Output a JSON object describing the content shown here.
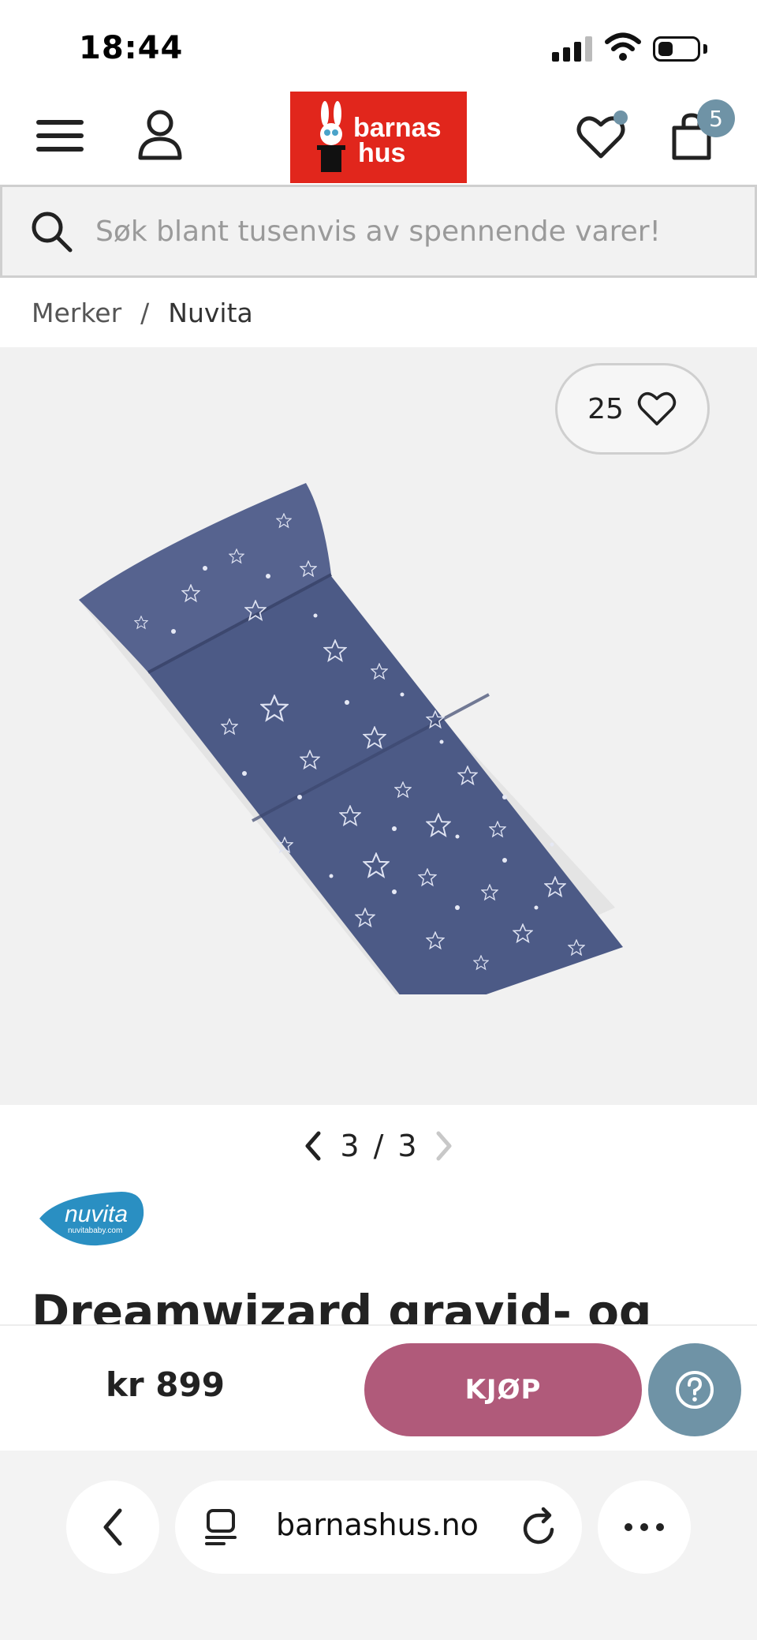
{
  "status_bar": {
    "time": "18:44"
  },
  "header": {
    "logo_text_line1": "barnas",
    "logo_text_line2": "hus",
    "cart_count": "5",
    "colors": {
      "logo_bg": "#e1261c",
      "badge": "#6f93a6"
    }
  },
  "search": {
    "placeholder": "Søk blant tusenvis av spennende varer!"
  },
  "breadcrumb": {
    "items": [
      "Merker",
      "Nuvita"
    ],
    "separator": "/"
  },
  "gallery": {
    "like_count": "25",
    "current": "3",
    "separator": "/",
    "total": "3"
  },
  "brand": {
    "logo_text": "nuvita",
    "logo_subtext": "nuvitababy.com"
  },
  "product": {
    "title": "Dreamwizard gravid- og"
  },
  "buy_bar": {
    "price": "kr 899",
    "buy_label": "KJØP",
    "colors": {
      "buy": "#b05a7a",
      "help": "#6f93a6"
    }
  },
  "browser": {
    "address": "barnashus.no"
  }
}
